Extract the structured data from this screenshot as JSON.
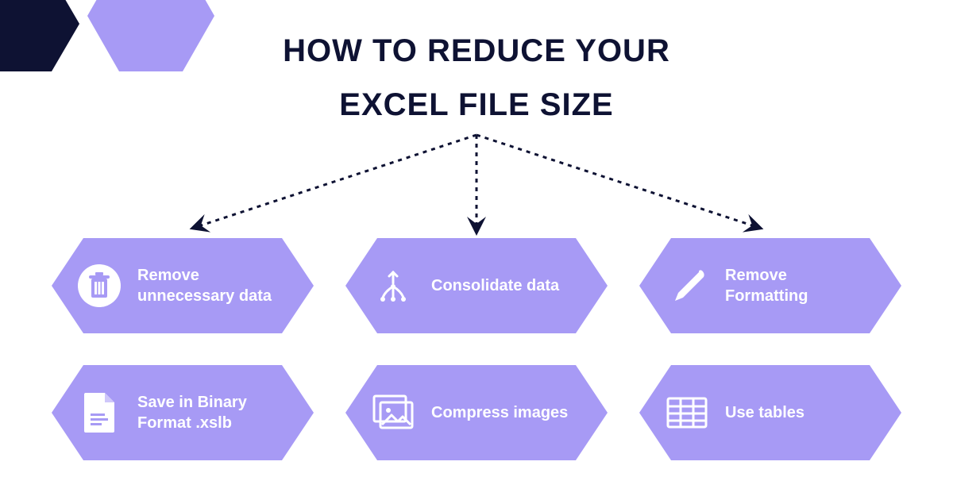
{
  "title": {
    "line1": "HOW TO REDUCE YOUR",
    "line2": "EXCEL FILE SIZE"
  },
  "colors": {
    "dark": "#0e1233",
    "lilac": "#a79af5"
  },
  "tips": [
    {
      "icon": "trash-icon",
      "label": "Remove unnecessary data"
    },
    {
      "icon": "merge-icon",
      "label": "Consolidate data"
    },
    {
      "icon": "brush-icon",
      "label": "Remove Formatting"
    },
    {
      "icon": "file-icon",
      "label": "Save in Binary Format .xslb"
    },
    {
      "icon": "images-icon",
      "label": "Compress images"
    },
    {
      "icon": "table-icon",
      "label": "Use tables"
    }
  ]
}
